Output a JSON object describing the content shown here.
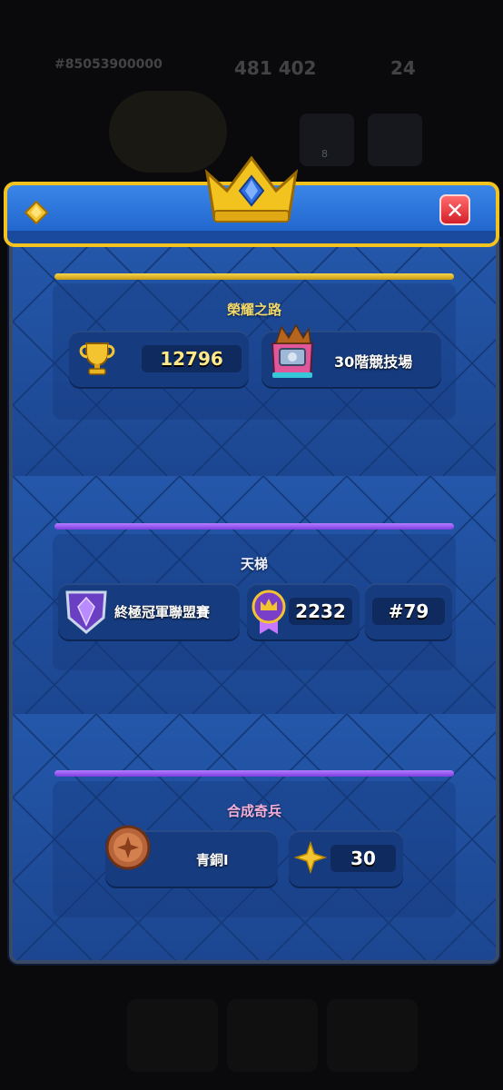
{
  "background": {
    "topbar_id": "#85053900000",
    "topbar_gold": "481 402",
    "topbar_gems": "24",
    "friends_count": "8"
  },
  "header": {
    "icon": "gem-diamond-icon",
    "close_icon": "close-icon",
    "crown_icon": "crown-icon"
  },
  "path_of_legends": {
    "title": "榮耀之路",
    "trophies": "12796",
    "arena": "30階競技場"
  },
  "ladder": {
    "title": "天梯",
    "league": "終極冠軍聯盟賽",
    "rating": "2232",
    "rank": "#79"
  },
  "merge_tactics": {
    "title": "合成奇兵",
    "rank_name": "青銅I",
    "stars": "30"
  },
  "colors": {
    "gold": "#f2c21f",
    "purple": "#9c5cf5",
    "panel_blue": "#1e4c9a",
    "close_red": "#d2202a"
  }
}
